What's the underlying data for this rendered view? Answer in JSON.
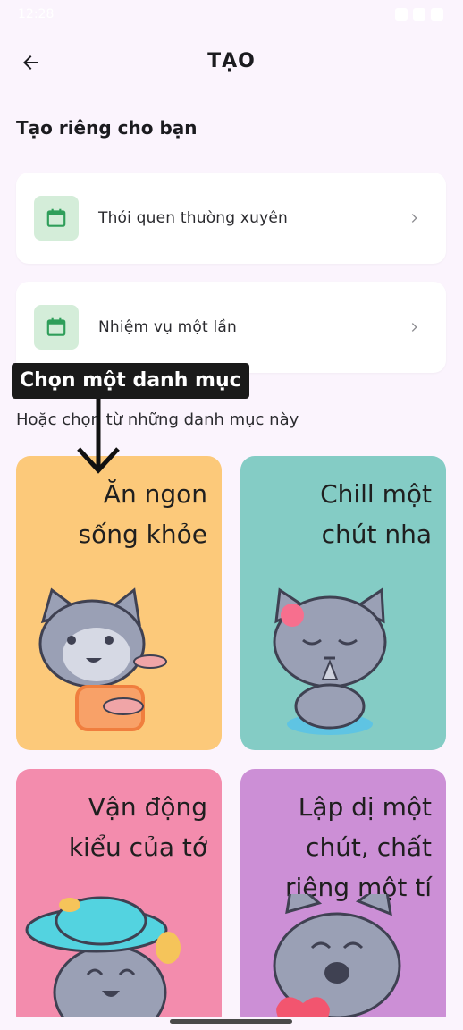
{
  "status_bar": {
    "time": "12:28"
  },
  "header": {
    "title": "TẠO"
  },
  "section_create": {
    "title": "Tạo riêng cho bạn"
  },
  "create_options": [
    {
      "label": "Thói quen thường xuyên",
      "icon": "calendar-icon"
    },
    {
      "label": "Nhiệm vụ một lần",
      "icon": "calendar-icon"
    }
  ],
  "tooltip": {
    "text": "Chọn một danh mục"
  },
  "section_categories": {
    "title": "Hoặc chọn từ những danh mục này"
  },
  "categories": [
    {
      "title": "Ăn ngon\nsống khỏe",
      "color": "#fcc97a"
    },
    {
      "title": "Chill một\nchút nha",
      "color": "#84ccc5"
    },
    {
      "title": "Vận động\nkiểu của tớ",
      "color": "#f38cad"
    },
    {
      "title": "Lập dị một\nchút, chất\nriêng một tí",
      "color": "#cc8fd6"
    }
  ],
  "colors": {
    "accent_green": "#2f9e5a",
    "background": "#fbf4fd"
  }
}
